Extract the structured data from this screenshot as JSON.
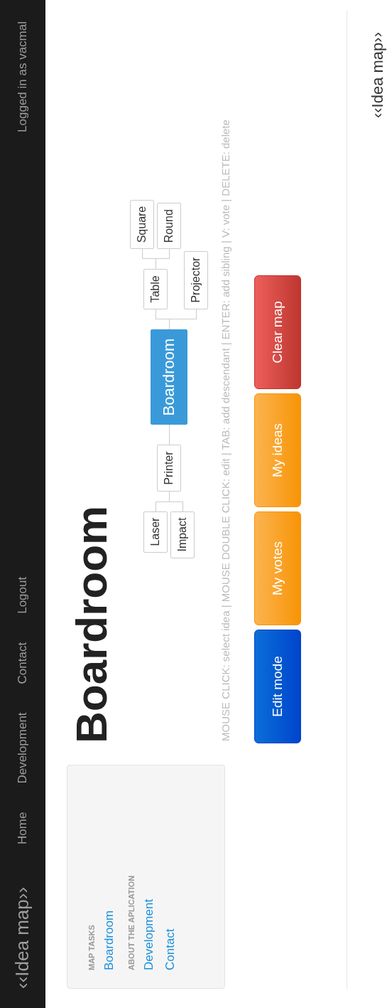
{
  "navbar": {
    "brand": "‹‹Idea map››",
    "links": [
      {
        "label": "Home"
      },
      {
        "label": "Development"
      },
      {
        "label": "Contact"
      },
      {
        "label": "Logout"
      }
    ],
    "user": "Logged in as vacmal"
  },
  "sidebar": {
    "sections": [
      {
        "heading": "MAP TASKS",
        "links": [
          "Boardroom"
        ]
      },
      {
        "heading": "ABOUT THE APLICATION",
        "links": [
          "Development",
          "Contact"
        ]
      }
    ]
  },
  "title": "Boardroom",
  "mind_map": {
    "root": {
      "label": "Boardroom",
      "selected": true
    },
    "left": [
      {
        "label": "Printer",
        "selected": false,
        "children": [
          {
            "label": "Laser",
            "selected": false
          },
          {
            "label": "Impact",
            "selected": false
          }
        ]
      }
    ],
    "right": [
      {
        "label": "Table",
        "selected": false,
        "children": [
          {
            "label": "Square",
            "selected": false
          },
          {
            "label": "Round",
            "selected": false
          }
        ]
      },
      {
        "label": "Projector",
        "selected": false
      }
    ]
  },
  "help": "MOUSE CLICK: select idea | MOUSE DOUBLE CLICK: edit | TAB: add descendant | ENTER: add sibling | V: vote | DELETE: delete",
  "buttons": [
    {
      "label": "Edit mode",
      "kind": "primary"
    },
    {
      "label": "My votes",
      "kind": "warning"
    },
    {
      "label": "My ideas",
      "kind": "warning"
    },
    {
      "label": "Clear map",
      "kind": "danger"
    }
  ],
  "footer": {
    "brand": "‹‹Idea map››"
  }
}
